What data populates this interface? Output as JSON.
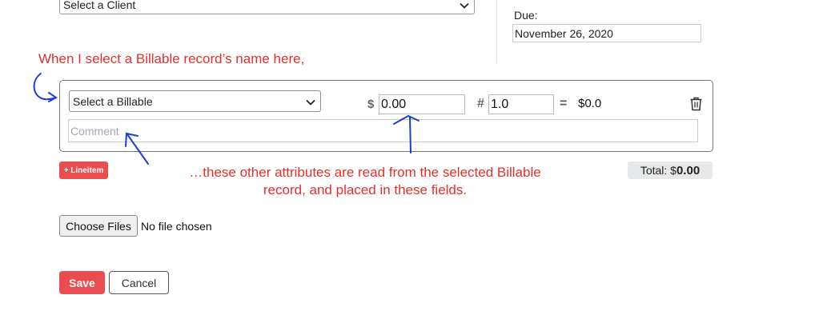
{
  "client_select": {
    "value": "Select a Client",
    "icon": "chevron-down-icon"
  },
  "due": {
    "label": "Due:",
    "value": "November 26, 2020"
  },
  "annotations": {
    "top": "When I select a Billable record’s name here,",
    "bottom_line1": "…these other attributes are read from the selected Billable",
    "bottom_line2": "record, and placed in these fields.",
    "color": "#e2302b",
    "arrow_color": "#1a3fd8"
  },
  "line_item": {
    "billable_select": "Select a Billable",
    "currency_symbol": "$",
    "price": "0.00",
    "quantity_symbol": "#",
    "quantity": "1.0",
    "equals": "=",
    "line_total": "$0.0",
    "delete_icon": "trash-icon",
    "comment_placeholder": "Comment"
  },
  "add_lineitem_label": "+ Lineitem",
  "total": {
    "label": "Total: $",
    "value": "0.00"
  },
  "file_upload": {
    "button_label": "Choose Files",
    "status": "No file chosen"
  },
  "actions": {
    "save_label": "Save",
    "cancel_label": "Cancel"
  },
  "colors": {
    "primary": "#ea4d4f",
    "badge_bg": "#e6e8ea"
  }
}
